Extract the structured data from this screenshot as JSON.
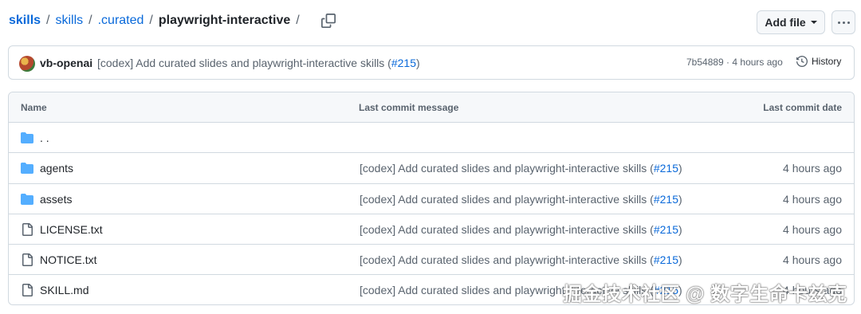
{
  "breadcrumb": {
    "items": [
      "skills",
      "skills",
      ".curated"
    ],
    "current": "playwright-interactive",
    "separator": "/"
  },
  "actions": {
    "add_file_label": "Add file"
  },
  "latest_commit": {
    "author": "vb-openai",
    "message": "[codex] Add curated slides and playwright-interactive skills (",
    "pr": "#215",
    "message_end": ")",
    "meta": "7b54889 · 4 hours ago",
    "history_label": "History"
  },
  "table": {
    "headers": {
      "name": "Name",
      "message": "Last commit message",
      "date": "Last commit date"
    },
    "parent": {
      "name": ". ."
    },
    "rows": [
      {
        "name": "agents",
        "type": "folder",
        "message": "[codex] Add curated slides and playwright-interactive skills (",
        "pr": "#215",
        "message_end": ")",
        "date": "4 hours ago"
      },
      {
        "name": "assets",
        "type": "folder",
        "message": "[codex] Add curated slides and playwright-interactive skills (",
        "pr": "#215",
        "message_end": ")",
        "date": "4 hours ago"
      },
      {
        "name": "LICENSE.txt",
        "type": "file",
        "message": "[codex] Add curated slides and playwright-interactive skills (",
        "pr": "#215",
        "message_end": ")",
        "date": "4 hours ago"
      },
      {
        "name": "NOTICE.txt",
        "type": "file",
        "message": "[codex] Add curated slides and playwright-interactive skills (",
        "pr": "#215",
        "message_end": ")",
        "date": "4 hours ago"
      },
      {
        "name": "SKILL.md",
        "type": "file",
        "message": "[codex] Add curated slides and playwright-interactive skills (",
        "pr": "#215",
        "message_end": ")",
        "date": "4 hours ago"
      }
    ]
  },
  "watermark": "掘金技术社区 @ 数字生命卡兹克",
  "colors": {
    "link": "#0969da",
    "folder": "#54aeff",
    "muted": "#59636e",
    "border": "#d1d9e0"
  }
}
